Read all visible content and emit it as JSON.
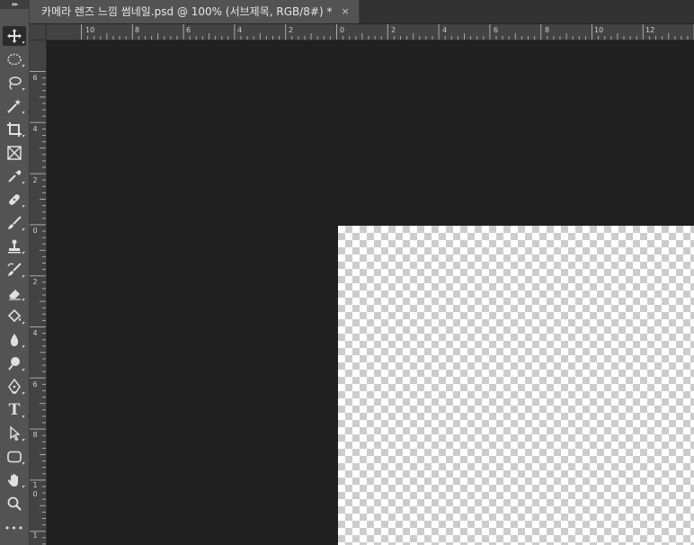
{
  "document_tab": {
    "title": "카메라 렌즈 느낌 썸네일.psd @ 100% (서브제목, RGB/8#) *",
    "close": "×"
  },
  "toolbar": {
    "collapse": "▸▸",
    "tools": [
      {
        "name": "move-tool",
        "icon": "move-icon",
        "active": true
      },
      {
        "name": "elliptical-marquee-tool",
        "icon": "ellipse-marquee-icon"
      },
      {
        "name": "lasso-tool",
        "icon": "lasso-icon"
      },
      {
        "name": "magic-wand-tool",
        "icon": "magic-wand-icon"
      },
      {
        "name": "crop-tool",
        "icon": "crop-icon"
      },
      {
        "name": "frame-tool",
        "icon": "frame-icon"
      },
      {
        "name": "eyedropper-tool",
        "icon": "eyedropper-icon"
      },
      {
        "name": "healing-brush-tool",
        "icon": "bandage-icon"
      },
      {
        "name": "brush-tool",
        "icon": "brush-icon"
      },
      {
        "name": "clone-stamp-tool",
        "icon": "stamp-icon"
      },
      {
        "name": "history-brush-tool",
        "icon": "history-brush-icon"
      },
      {
        "name": "eraser-tool",
        "icon": "eraser-icon"
      },
      {
        "name": "paint-bucket-tool",
        "icon": "paint-bucket-icon"
      },
      {
        "name": "blur-tool",
        "icon": "drop-icon"
      },
      {
        "name": "dodge-tool",
        "icon": "dodge-icon"
      },
      {
        "name": "pen-tool",
        "icon": "pen-icon"
      },
      {
        "name": "type-tool",
        "icon": "type-icon",
        "label": "T"
      },
      {
        "name": "path-selection-tool",
        "icon": "arrow-icon"
      },
      {
        "name": "rectangle-tool",
        "icon": "rounded-rect-icon"
      },
      {
        "name": "hand-tool",
        "icon": "hand-icon"
      },
      {
        "name": "zoom-tool",
        "icon": "magnifier-icon"
      },
      {
        "name": "more-tools",
        "icon": "ellipsis-icon",
        "label": "•••"
      }
    ]
  },
  "rulers": {
    "horizontal_labels": [
      "10",
      "8",
      "6",
      "4",
      "2",
      "0",
      "2",
      "4",
      "6",
      "8",
      "10",
      "12"
    ],
    "vertical_labels": [
      "6",
      "4",
      "2",
      "0",
      "2",
      "4",
      "6",
      "8",
      "1 0",
      "1"
    ]
  },
  "colors": {
    "pasteboard": "#202020",
    "toolbar": "#535353",
    "ruler": "#434343",
    "checker_light": "#ffffff",
    "checker_dark": "#cccccc"
  }
}
